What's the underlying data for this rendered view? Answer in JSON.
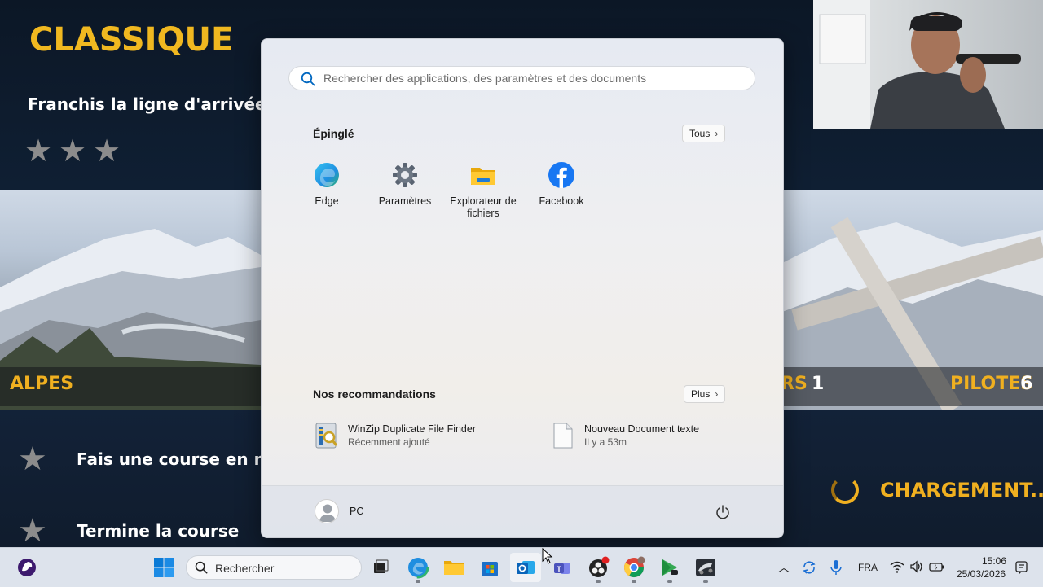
{
  "game": {
    "title": "CLASSIQUE",
    "subtitle": "Franchis la ligne d'arrivée en pre",
    "banner": {
      "left_label": "ALPES",
      "mid_label": "RS",
      "mid_value": "1",
      "right_label": "PILOTES",
      "right_value": "6"
    },
    "objectives": [
      "Fais une course en moins",
      "Termine la course"
    ],
    "loading_text": "CHARGEMENT..."
  },
  "start_menu": {
    "search": {
      "placeholder": "Rechercher des applications, des paramètres et des documents"
    },
    "pinned": {
      "title": "Épinglé",
      "all_button": "Tous",
      "apps": [
        {
          "label": "Edge",
          "icon": "edge-icon"
        },
        {
          "label": "Paramètres",
          "icon": "gear-icon"
        },
        {
          "label": "Explorateur de fichiers",
          "icon": "folder-icon"
        },
        {
          "label": "Facebook",
          "icon": "facebook-icon"
        }
      ]
    },
    "recommendations": {
      "title": "Nos recommandations",
      "more_button": "Plus",
      "items": [
        {
          "name": "WinZip Duplicate File Finder",
          "sub": "Récemment ajouté",
          "icon": "winzip-icon"
        },
        {
          "name": "Nouveau Document texte",
          "sub": "Il y a 53m",
          "icon": "text-document-icon"
        }
      ]
    },
    "user": {
      "name": "PC"
    }
  },
  "taskbar": {
    "search_label": "Rechercher",
    "language": "FRA",
    "time": "15:06",
    "date": "25/03/2026",
    "colors": {
      "accent": "#0067c0",
      "taskbar_bg": "#dde3ec"
    }
  }
}
